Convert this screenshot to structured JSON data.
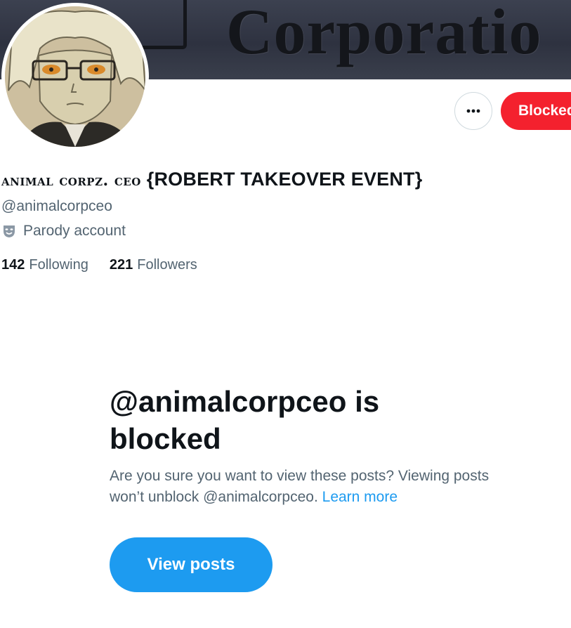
{
  "banner": {
    "text": "Corporatio"
  },
  "actions": {
    "more_icon": "ellipsis-icon",
    "blocked_label": "Blocked"
  },
  "profile": {
    "name_stylized": "Animal corpz. ceo",
    "name_rest": "{ROBERT TAKEOVER EVENT}",
    "handle": "@animalcorpceo",
    "parody_icon": "theater-masks-icon",
    "parody_label": "Parody account",
    "following_count": "142",
    "following_label": "Following",
    "followers_count": "221",
    "followers_label": "Followers"
  },
  "blocked_notice": {
    "title": "@animalcorpceo is blocked",
    "body": "Are you sure you want to view these posts? Viewing posts won’t unblock @animalcorpceo.",
    "link": "Learn more",
    "button_label": "View posts"
  },
  "colors": {
    "text_primary": "#0f1419",
    "text_secondary": "#536471",
    "accent": "#1d9bf0",
    "danger": "#f4212e",
    "border": "#cfd9de"
  }
}
